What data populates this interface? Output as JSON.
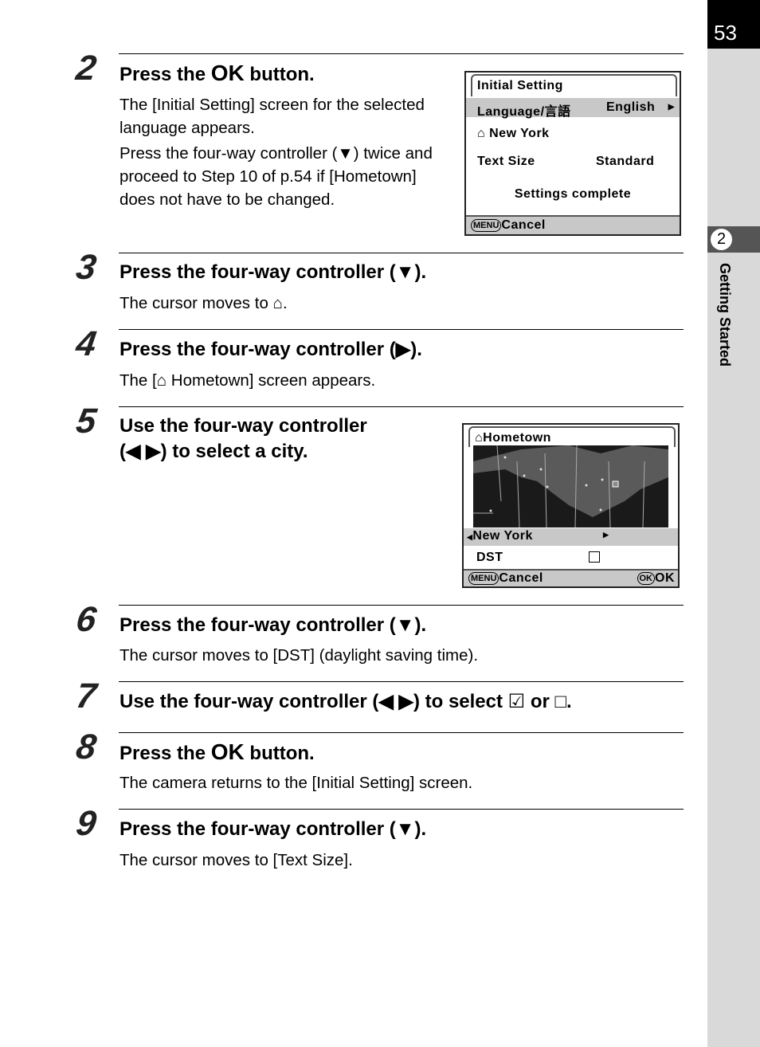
{
  "page_number": "53",
  "chapter": {
    "number": "2",
    "title": "Getting Started"
  },
  "steps": [
    {
      "num": "2",
      "heading_pre": "Press the ",
      "heading_ok": "OK",
      "heading_post": " button.",
      "body": [
        "The [Initial Setting] screen for the selected language appears.",
        "Press the four-way controller (▼) twice and proceed to Step 10 of p.54 if [Hometown] does not have to be changed."
      ]
    },
    {
      "num": "3",
      "heading": "Press the four-way controller (▼).",
      "body_pre": "The cursor moves to ",
      "body_post": "."
    },
    {
      "num": "4",
      "heading": "Press the four-way controller (▶).",
      "body_pre": "The [",
      "body_post": " Hometown] screen appears."
    },
    {
      "num": "5",
      "heading_lines": [
        "Use the four-way controller",
        "(◀ ▶) to select a city."
      ]
    },
    {
      "num": "6",
      "heading": "Press the four-way controller (▼).",
      "body": "The cursor moves to [DST] (daylight saving time)."
    },
    {
      "num": "7",
      "heading_pre": "Use the four-way controller (◀ ▶) to select ",
      "heading_mid": " or ",
      "heading_post": "□."
    },
    {
      "num": "8",
      "heading_pre": "Press the ",
      "heading_ok": "OK",
      "heading_post": " button.",
      "body": "The camera returns to the [Initial Setting] screen."
    },
    {
      "num": "9",
      "heading": "Press the four-way controller (▼).",
      "body": "The cursor moves to [Text Size]."
    }
  ],
  "screen1": {
    "title": "Initial Setting",
    "language_label": "Language/言語",
    "language_value": "English",
    "hometown": "New York",
    "text_size_label": "Text Size",
    "text_size_value": "Standard",
    "complete": "Settings complete",
    "menu_btn": "MENU",
    "cancel": "Cancel"
  },
  "screen2": {
    "title": "Hometown",
    "city": "New York",
    "dst_label": "DST",
    "dst_checked": false,
    "menu_btn": "MENU",
    "cancel": "Cancel",
    "ok_btn": "OK",
    "ok": "OK"
  }
}
